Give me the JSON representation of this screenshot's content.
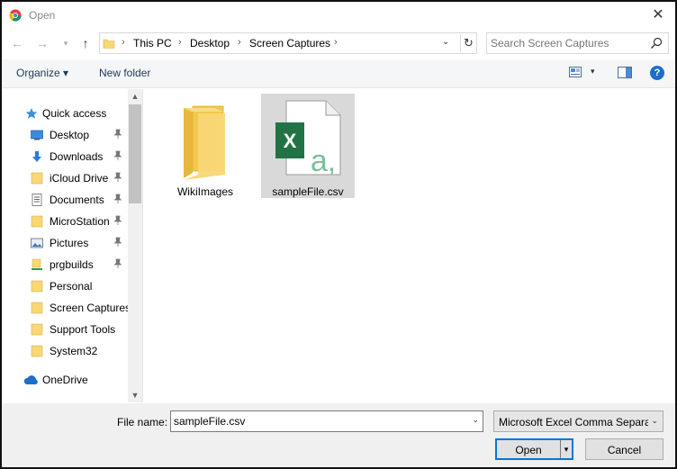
{
  "window": {
    "title": "Open",
    "close_glyph": "✕"
  },
  "navigation": {
    "back_glyph": "←",
    "forward_glyph": "→",
    "recent_glyph": "▾",
    "up_glyph": "↑",
    "breadcrumbs": [
      "This PC",
      "Desktop",
      "Screen Captures"
    ],
    "separator": "›",
    "dropdown_glyph": "⌄",
    "refresh_glyph": "↻",
    "search_placeholder": "Search Screen Captures"
  },
  "toolbar": {
    "organize_label": "Organize ▾",
    "new_folder_label": "New folder",
    "views_arrow": "▾",
    "help_label": "?"
  },
  "sidebar": {
    "scroll_up": "▲",
    "scroll_down": "▼",
    "items": [
      {
        "label": "Quick access",
        "icon": "star-icon",
        "pinned": false
      },
      {
        "label": "Desktop",
        "icon": "desktop-icon",
        "pinned": true
      },
      {
        "label": "Downloads",
        "icon": "download-icon",
        "pinned": true
      },
      {
        "label": "iCloud Drive",
        "icon": "folder-icon",
        "pinned": true
      },
      {
        "label": "Documents",
        "icon": "documents-icon",
        "pinned": true
      },
      {
        "label": "MicroStation",
        "icon": "folder-icon",
        "pinned": true
      },
      {
        "label": "Pictures",
        "icon": "pictures-icon",
        "pinned": true
      },
      {
        "label": "prgbuilds",
        "icon": "network-folder-icon",
        "pinned": true
      },
      {
        "label": "Personal",
        "icon": "folder-icon",
        "pinned": false
      },
      {
        "label": "Screen Captures",
        "icon": "folder-icon",
        "pinned": false
      },
      {
        "label": "Support Tools",
        "icon": "folder-icon",
        "pinned": false
      },
      {
        "label": "System32",
        "icon": "folder-icon",
        "pinned": false
      },
      {
        "label": "OneDrive",
        "icon": "cloud-icon",
        "pinned": false
      }
    ]
  },
  "files": [
    {
      "name": "WikiImages",
      "type": "folder",
      "selected": false
    },
    {
      "name": "sampleFile.csv",
      "type": "excel-csv",
      "selected": true
    }
  ],
  "bottom": {
    "file_name_label": "File name:",
    "file_name_value": "sampleFile.csv",
    "file_name_arrow": "⌄",
    "file_type_value": "Microsoft Excel Comma Separa",
    "file_type_arrow": "⌄",
    "open_label": "Open",
    "open_split_arrow": "▾",
    "cancel_label": "Cancel"
  },
  "colors": {
    "accent": "#0078d7",
    "folder": "#f8d775",
    "excel_green": "#217346",
    "selection": "#d9d9d9",
    "link_text": "#1e395b"
  }
}
